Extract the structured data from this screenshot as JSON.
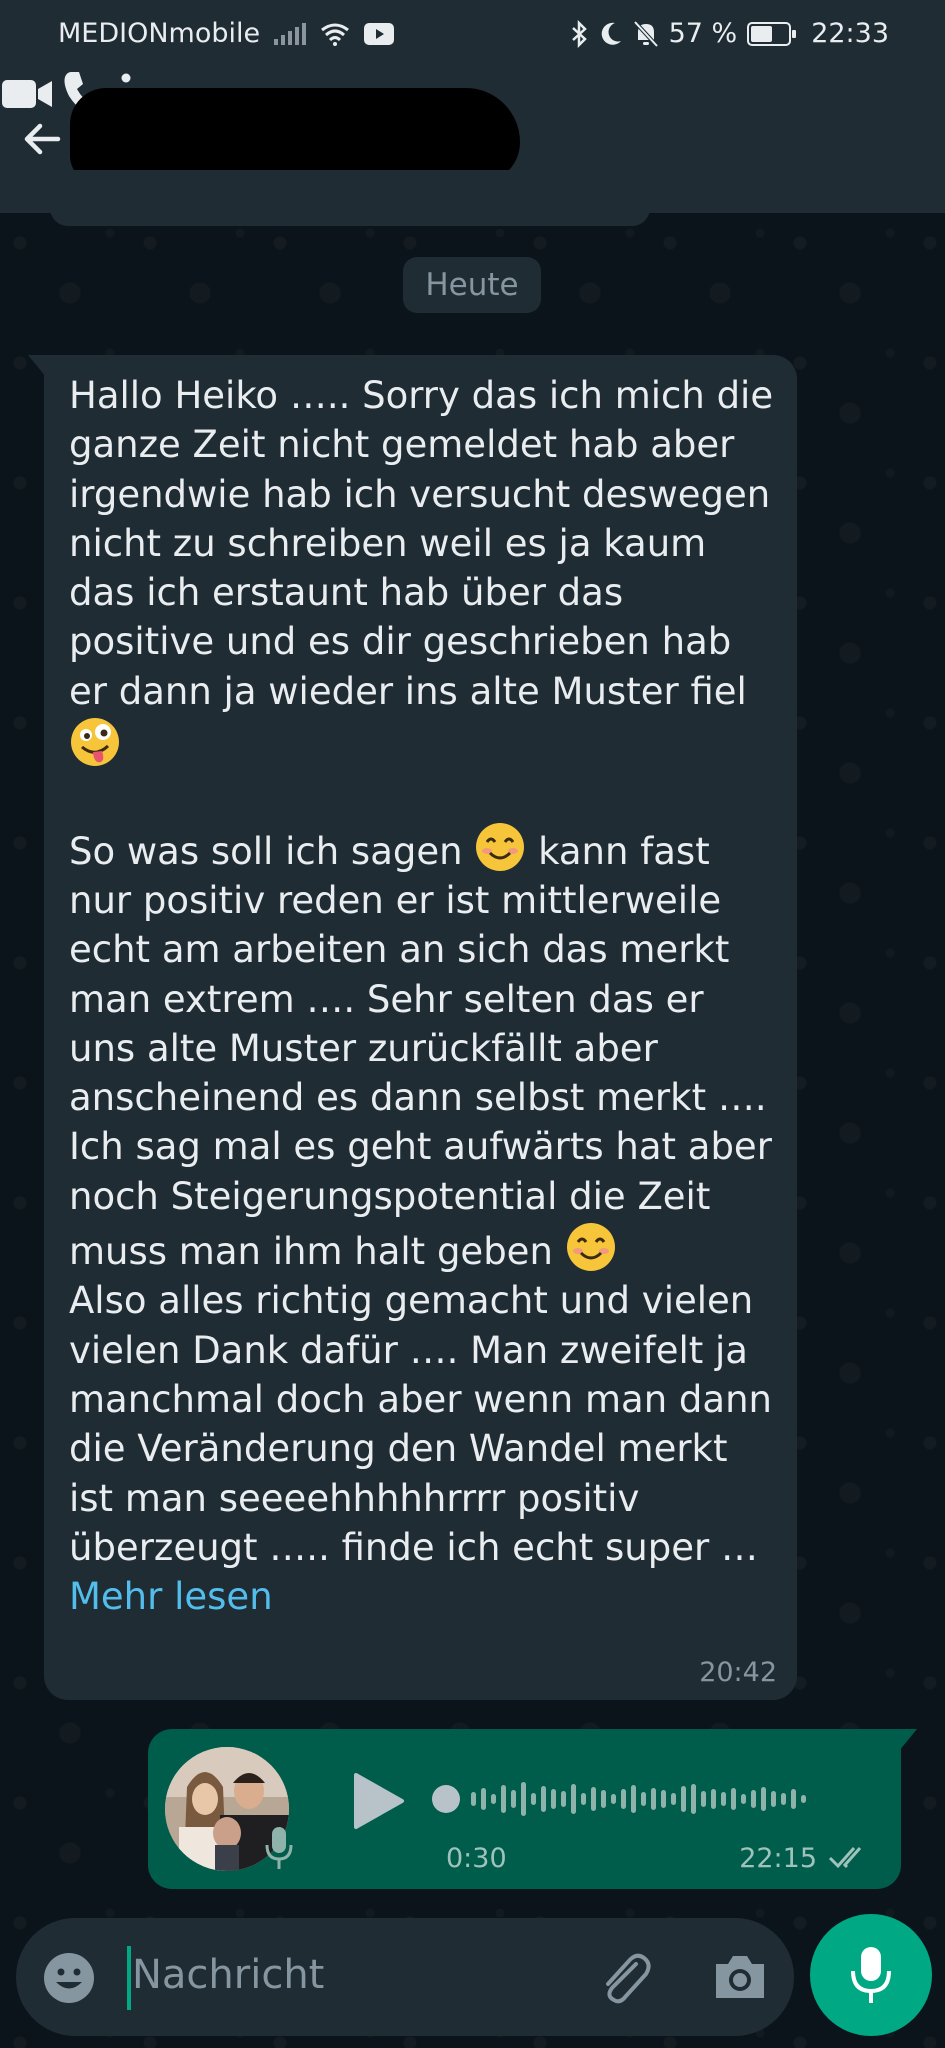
{
  "status_bar": {
    "carrier": "MEDIONmobile",
    "battery_percent": "57 %",
    "battery_level": 0.57,
    "time": "22:33"
  },
  "header": {
    "contact_name_redacted": true
  },
  "date_chip": "Heute",
  "incoming_message": {
    "paragraph1": "Hallo Heiko ….. Sorry das ich mich die ganze Zeit nicht gemeldet hab aber irgendwie hab ich versucht deswegen nicht zu schreiben weil es ja kaum das ich erstaunt hab über das positive und es dir geschrieben hab er dann ja wieder ins alte Muster fiel",
    "paragraph2_a": "So was soll ich sagen",
    "paragraph2_b": "kann fast nur positiv reden er ist mittlerweile echt am arbeiten an sich das merkt man extrem …. Sehr selten das er uns alte Muster zurückfällt aber anscheinend es dann selbst merkt …. Ich sag mal es geht aufwärts hat aber noch Steigerungspotential die Zeit muss man ihm halt geben",
    "paragraph3": "Also alles richtig gemacht und vielen vielen Dank dafür …. Man zweifelt ja manchmal doch aber wenn man dann die Veränderung den Wandel merkt ist man seeeehhhhhrrrr positiv überzeugt ….. finde ich echt super …",
    "more_label": "Mehr lesen",
    "time": "20:42",
    "emojis": [
      "zany-face-emoji",
      "smiling-face-emoji",
      "smiling-face-emoji"
    ]
  },
  "voice_message": {
    "duration": "0:30",
    "time": "22:15",
    "status": "read"
  },
  "composer": {
    "placeholder": "Nachricht"
  },
  "colors": {
    "header_bg": "#1f2c34",
    "chat_bg": "#0b141a",
    "incoming_bubble": "#1f2c34",
    "outgoing_bubble": "#005c4b",
    "accent": "#00a884",
    "link": "#53bdeb"
  }
}
